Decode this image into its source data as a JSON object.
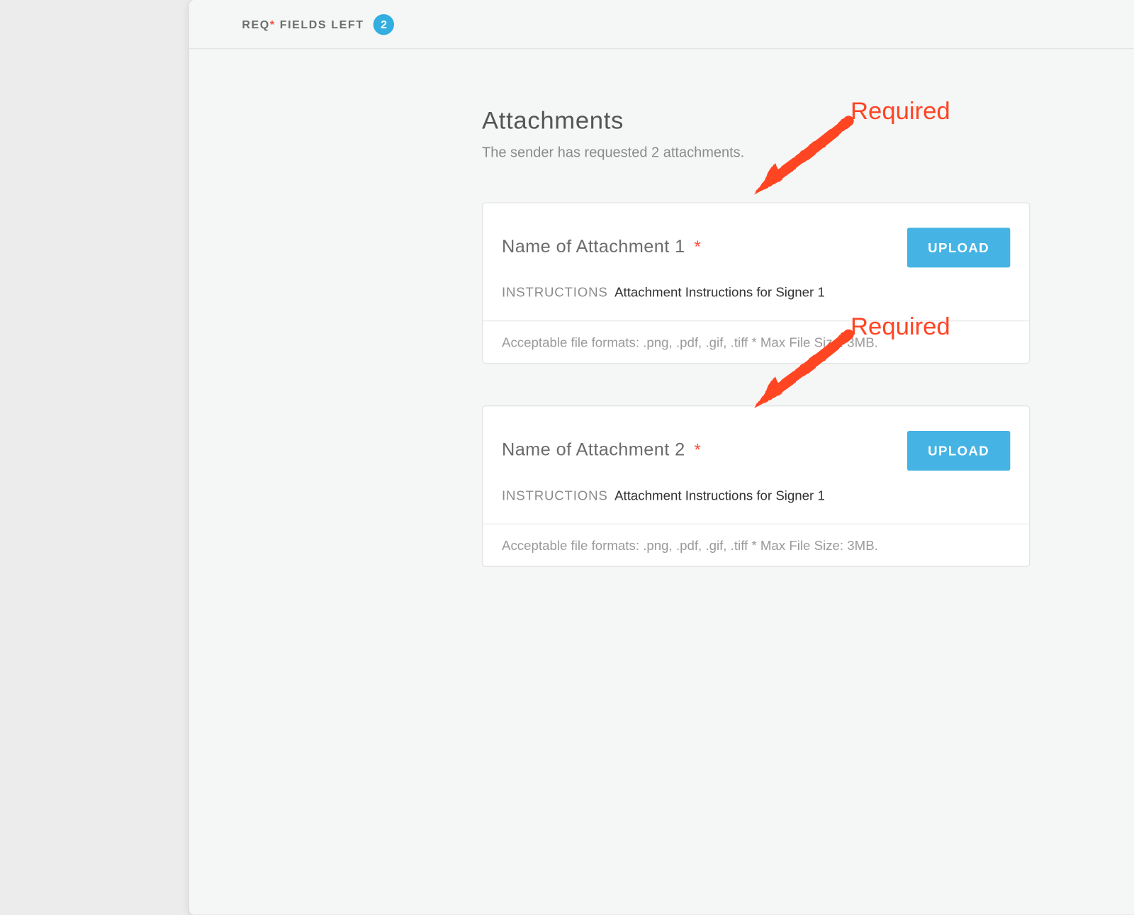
{
  "topbar": {
    "req_prefix": "REQ",
    "req_suffix": " FIELDS LEFT",
    "count": "2"
  },
  "section": {
    "title": "Attachments",
    "subtitle": "The sender has requested 2 attachments."
  },
  "attachments": [
    {
      "title": "Name of Attachment 1",
      "required_mark": "*",
      "upload_label": "UPLOAD",
      "instructions_label": "INSTRUCTIONS",
      "instructions_text": "Attachment Instructions for Signer 1",
      "footer": "Acceptable file formats: .png, .pdf, .gif, .tiff * Max File Size: 3MB."
    },
    {
      "title": "Name of Attachment 2",
      "required_mark": "*",
      "upload_label": "UPLOAD",
      "instructions_label": "INSTRUCTIONS",
      "instructions_text": "Attachment Instructions for Signer 1",
      "footer": "Acceptable file formats: .png, .pdf, .gif, .tiff * Max File Size: 3MB."
    }
  ],
  "annotations": {
    "label": "Required"
  }
}
